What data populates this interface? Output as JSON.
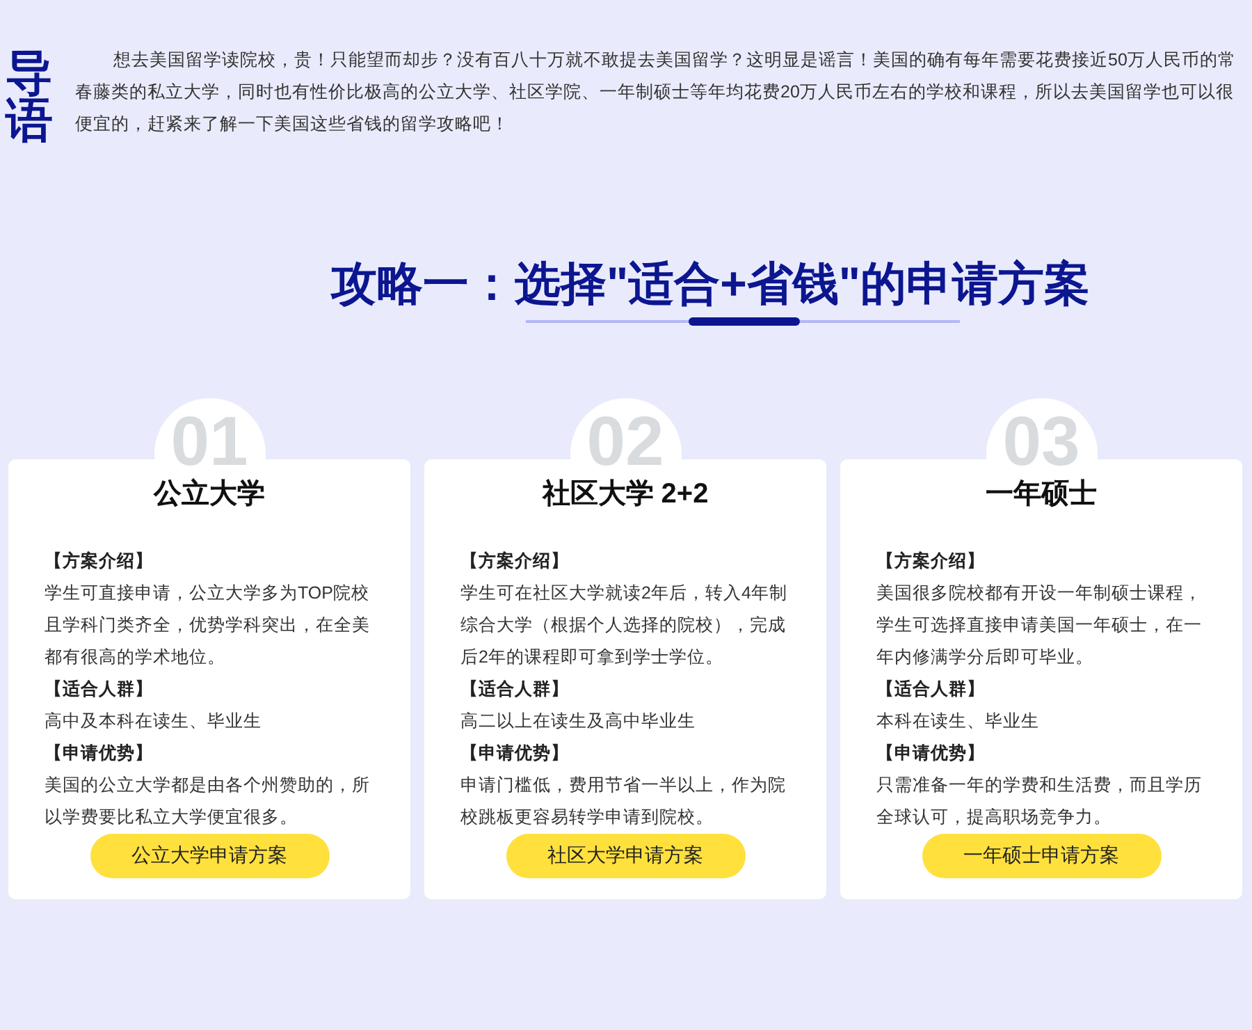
{
  "intro": {
    "label": "导语",
    "text": "想去美国留学读院校，贵！只能望而却步？没有百八十万就不敢提去美国留学？这明显是谣言！美国的确有每年需要花费接近50万人民币的常春藤类的私立大学，同时也有性价比极高的公立大学、社区学院、一年制硕士等年均花费20万人民币左右的学校和课程，所以去美国留学也可以很便宜的，赶紧来了解一下美国这些省钱的留学攻略吧！"
  },
  "heading": "攻略一：选择\"适合+省钱\"的申请方案",
  "cards": [
    {
      "number": "01",
      "title": "公立大学",
      "sections": [
        {
          "heading": "【方案介绍】",
          "text": "学生可直接申请，公立大学多为TOP院校且学科门类齐全，优势学科突出，在全美都有很高的学术地位。"
        },
        {
          "heading": "【适合人群】",
          "text": "高中及本科在读生、毕业生"
        },
        {
          "heading": "【申请优势】",
          "text": "美国的公立大学都是由各个州赞助的，所以学费要比私立大学便宜很多。"
        }
      ],
      "button": "公立大学申请方案"
    },
    {
      "number": "02",
      "title": "社区大学 2+2",
      "sections": [
        {
          "heading": "【方案介绍】",
          "text": "学生可在社区大学就读2年后，转入4年制综合大学（根据个人选择的院校），完成后2年的课程即可拿到学士学位。"
        },
        {
          "heading": "【适合人群】",
          "text": "高二以上在读生及高中毕业生"
        },
        {
          "heading": "【申请优势】",
          "text": "申请门槛低，费用节省一半以上，作为院校跳板更容易转学申请到院校。"
        }
      ],
      "button": "社区大学申请方案"
    },
    {
      "number": "03",
      "title": "一年硕士",
      "sections": [
        {
          "heading": "【方案介绍】",
          "text": "美国很多院校都有开设一年制硕士课程，学生可选择直接申请美国一年硕士，在一年内修满学分后即可毕业。"
        },
        {
          "heading": "【适合人群】",
          "text": "本科在读生、毕业生"
        },
        {
          "heading": "【申请优势】",
          "text": "只需准备一年的学费和生活费，而且学历全球认可，提高职场竞争力。"
        }
      ],
      "button": "一年硕士申请方案"
    }
  ]
}
